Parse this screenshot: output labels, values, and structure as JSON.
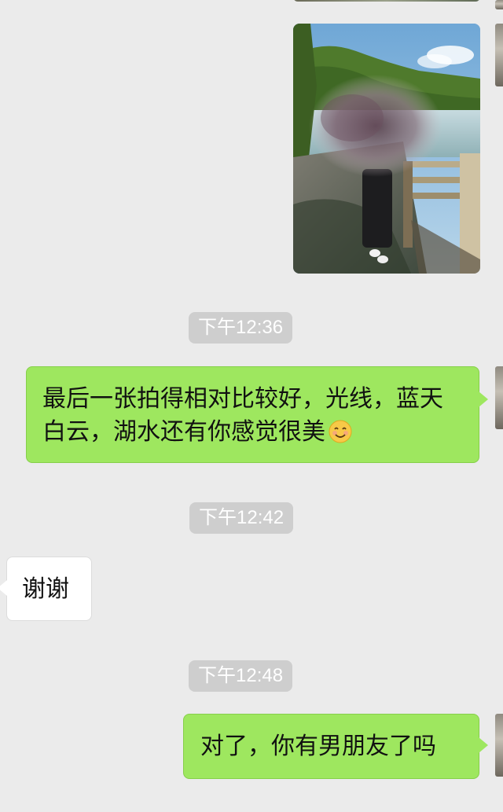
{
  "messages": [
    {
      "type": "image",
      "sender": "me"
    },
    {
      "type": "timestamp",
      "text": "下午12:36"
    },
    {
      "type": "text",
      "sender": "me",
      "text": "最后一张拍得相对比较好，光线，蓝天白云，湖水还有你感觉很美",
      "emoji": "smiling-face-icon"
    },
    {
      "type": "timestamp",
      "text": "下午12:42"
    },
    {
      "type": "text",
      "sender": "them",
      "text": "谢谢"
    },
    {
      "type": "timestamp",
      "text": "下午12:48"
    },
    {
      "type": "text",
      "sender": "me",
      "text": "对了，你有男朋友了吗"
    }
  ],
  "colors": {
    "background": "#ebebeb",
    "bubble_me": "#9ee75f",
    "bubble_them": "#ffffff",
    "timestamp_bg": "#cecece"
  }
}
